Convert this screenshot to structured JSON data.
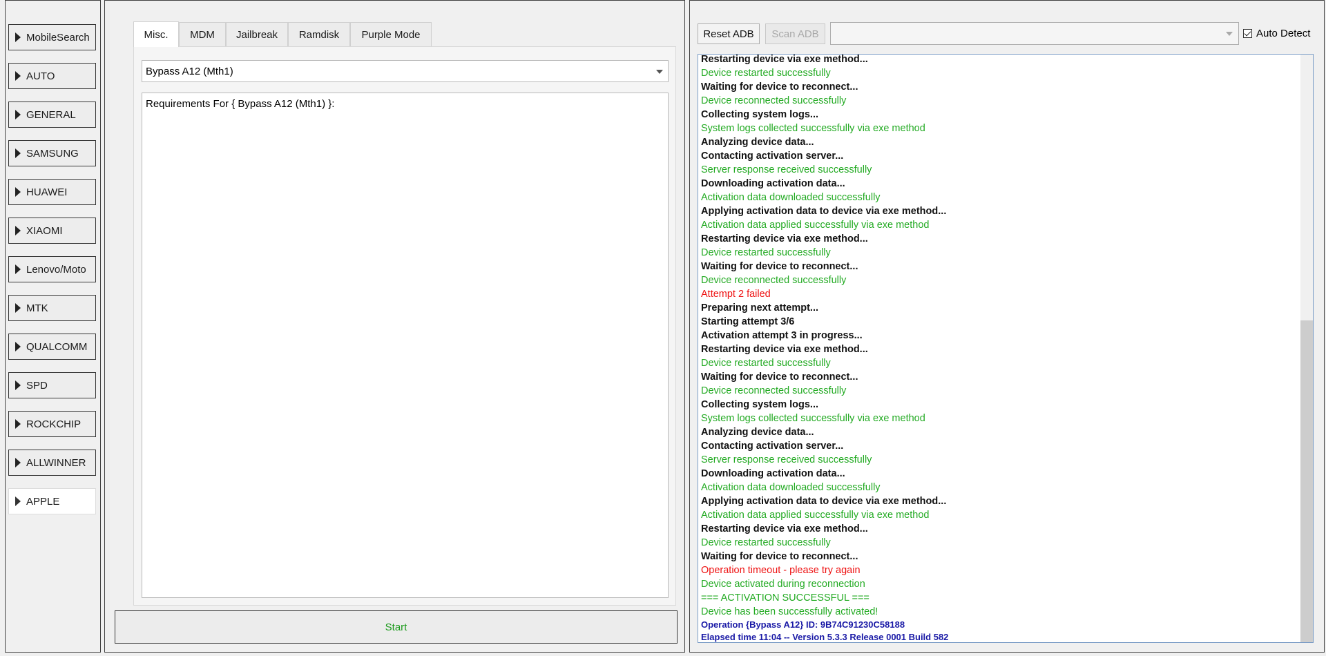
{
  "sidebar": {
    "items": [
      {
        "label": "MobileSearch"
      },
      {
        "label": "AUTO"
      },
      {
        "label": "GENERAL"
      },
      {
        "label": "SAMSUNG"
      },
      {
        "label": "HUAWEI"
      },
      {
        "label": "XIAOMI"
      },
      {
        "label": "Lenovo/Moto"
      },
      {
        "label": "MTK"
      },
      {
        "label": "QUALCOMM"
      },
      {
        "label": "SPD"
      },
      {
        "label": "ROCKCHIP"
      },
      {
        "label": "ALLWINNER"
      },
      {
        "label": "APPLE"
      }
    ],
    "selected": "APPLE"
  },
  "tabs": [
    {
      "label": "Misc."
    },
    {
      "label": "MDM"
    },
    {
      "label": "Jailbreak"
    },
    {
      "label": "Ramdisk"
    },
    {
      "label": "Purple Mode"
    }
  ],
  "active_tab": "Misc.",
  "method": {
    "selected": "Bypass A12 (Mth1)"
  },
  "requirements": {
    "text": "Requirements For { Bypass A12 (Mth1) }:"
  },
  "start_label": "Start",
  "toolbar": {
    "reset_adb": "Reset ADB",
    "scan_adb": "Scan ADB",
    "device_value": "",
    "auto_detect_label": "Auto Detect",
    "auto_detect_checked": true
  },
  "log": [
    {
      "text": "Restarting device via exe method...",
      "type": "status"
    },
    {
      "text": "Device restarted successfully",
      "type": "success"
    },
    {
      "text": "Waiting for device to reconnect...",
      "type": "status"
    },
    {
      "text": "Device reconnected successfully",
      "type": "success"
    },
    {
      "text": "Collecting system logs...",
      "type": "status"
    },
    {
      "text": "System logs collected successfully via exe method",
      "type": "success"
    },
    {
      "text": "Analyzing device data...",
      "type": "status"
    },
    {
      "text": "Contacting activation server...",
      "type": "status"
    },
    {
      "text": "Server response received successfully",
      "type": "success"
    },
    {
      "text": "Downloading activation data...",
      "type": "status"
    },
    {
      "text": "Activation data downloaded successfully",
      "type": "success"
    },
    {
      "text": "Applying activation data to device via exe method...",
      "type": "status"
    },
    {
      "text": "Activation data applied successfully via exe method",
      "type": "success"
    },
    {
      "text": "Restarting device via exe method...",
      "type": "status"
    },
    {
      "text": "Device restarted successfully",
      "type": "success"
    },
    {
      "text": "Waiting for device to reconnect...",
      "type": "status"
    },
    {
      "text": "Device reconnected successfully",
      "type": "success"
    },
    {
      "text": "Attempt 2 failed",
      "type": "error"
    },
    {
      "text": "Preparing next attempt...",
      "type": "status"
    },
    {
      "text": "Starting attempt 3/6",
      "type": "status"
    },
    {
      "text": "Activation attempt 3 in progress...",
      "type": "status"
    },
    {
      "text": "Restarting device via exe method...",
      "type": "status"
    },
    {
      "text": "Device restarted successfully",
      "type": "success"
    },
    {
      "text": "Waiting for device to reconnect...",
      "type": "status"
    },
    {
      "text": "Device reconnected successfully",
      "type": "success"
    },
    {
      "text": "Collecting system logs...",
      "type": "status"
    },
    {
      "text": "System logs collected successfully via exe method",
      "type": "success"
    },
    {
      "text": "Analyzing device data...",
      "type": "status"
    },
    {
      "text": "Contacting activation server...",
      "type": "status"
    },
    {
      "text": "Server response received successfully",
      "type": "success"
    },
    {
      "text": "Downloading activation data...",
      "type": "status"
    },
    {
      "text": "Activation data downloaded successfully",
      "type": "success"
    },
    {
      "text": "Applying activation data to device via exe method...",
      "type": "status"
    },
    {
      "text": "Activation data applied successfully via exe method",
      "type": "success"
    },
    {
      "text": "Restarting device via exe method...",
      "type": "status"
    },
    {
      "text": "Device restarted successfully",
      "type": "success"
    },
    {
      "text": "Waiting for device to reconnect...",
      "type": "status"
    },
    {
      "text": "Operation timeout - please try again",
      "type": "error"
    },
    {
      "text": "Device activated during reconnection",
      "type": "success"
    },
    {
      "text": "=== ACTIVATION SUCCESSFUL ===",
      "type": "success"
    },
    {
      "text": "Device has been successfully activated!",
      "type": "success"
    },
    {
      "text": "Operation {Bypass A12} ID: 9B74C91230C58188",
      "type": "info"
    },
    {
      "text": "Elapsed time 11:04 -- Version 5.3.3 Release 0001 Build 582",
      "type": "info"
    }
  ],
  "colors": {
    "status": "#111111",
    "success": "#22aa22",
    "error": "#ee1111",
    "info": "#1a1aa6",
    "start_text": "#1b9a1b"
  }
}
